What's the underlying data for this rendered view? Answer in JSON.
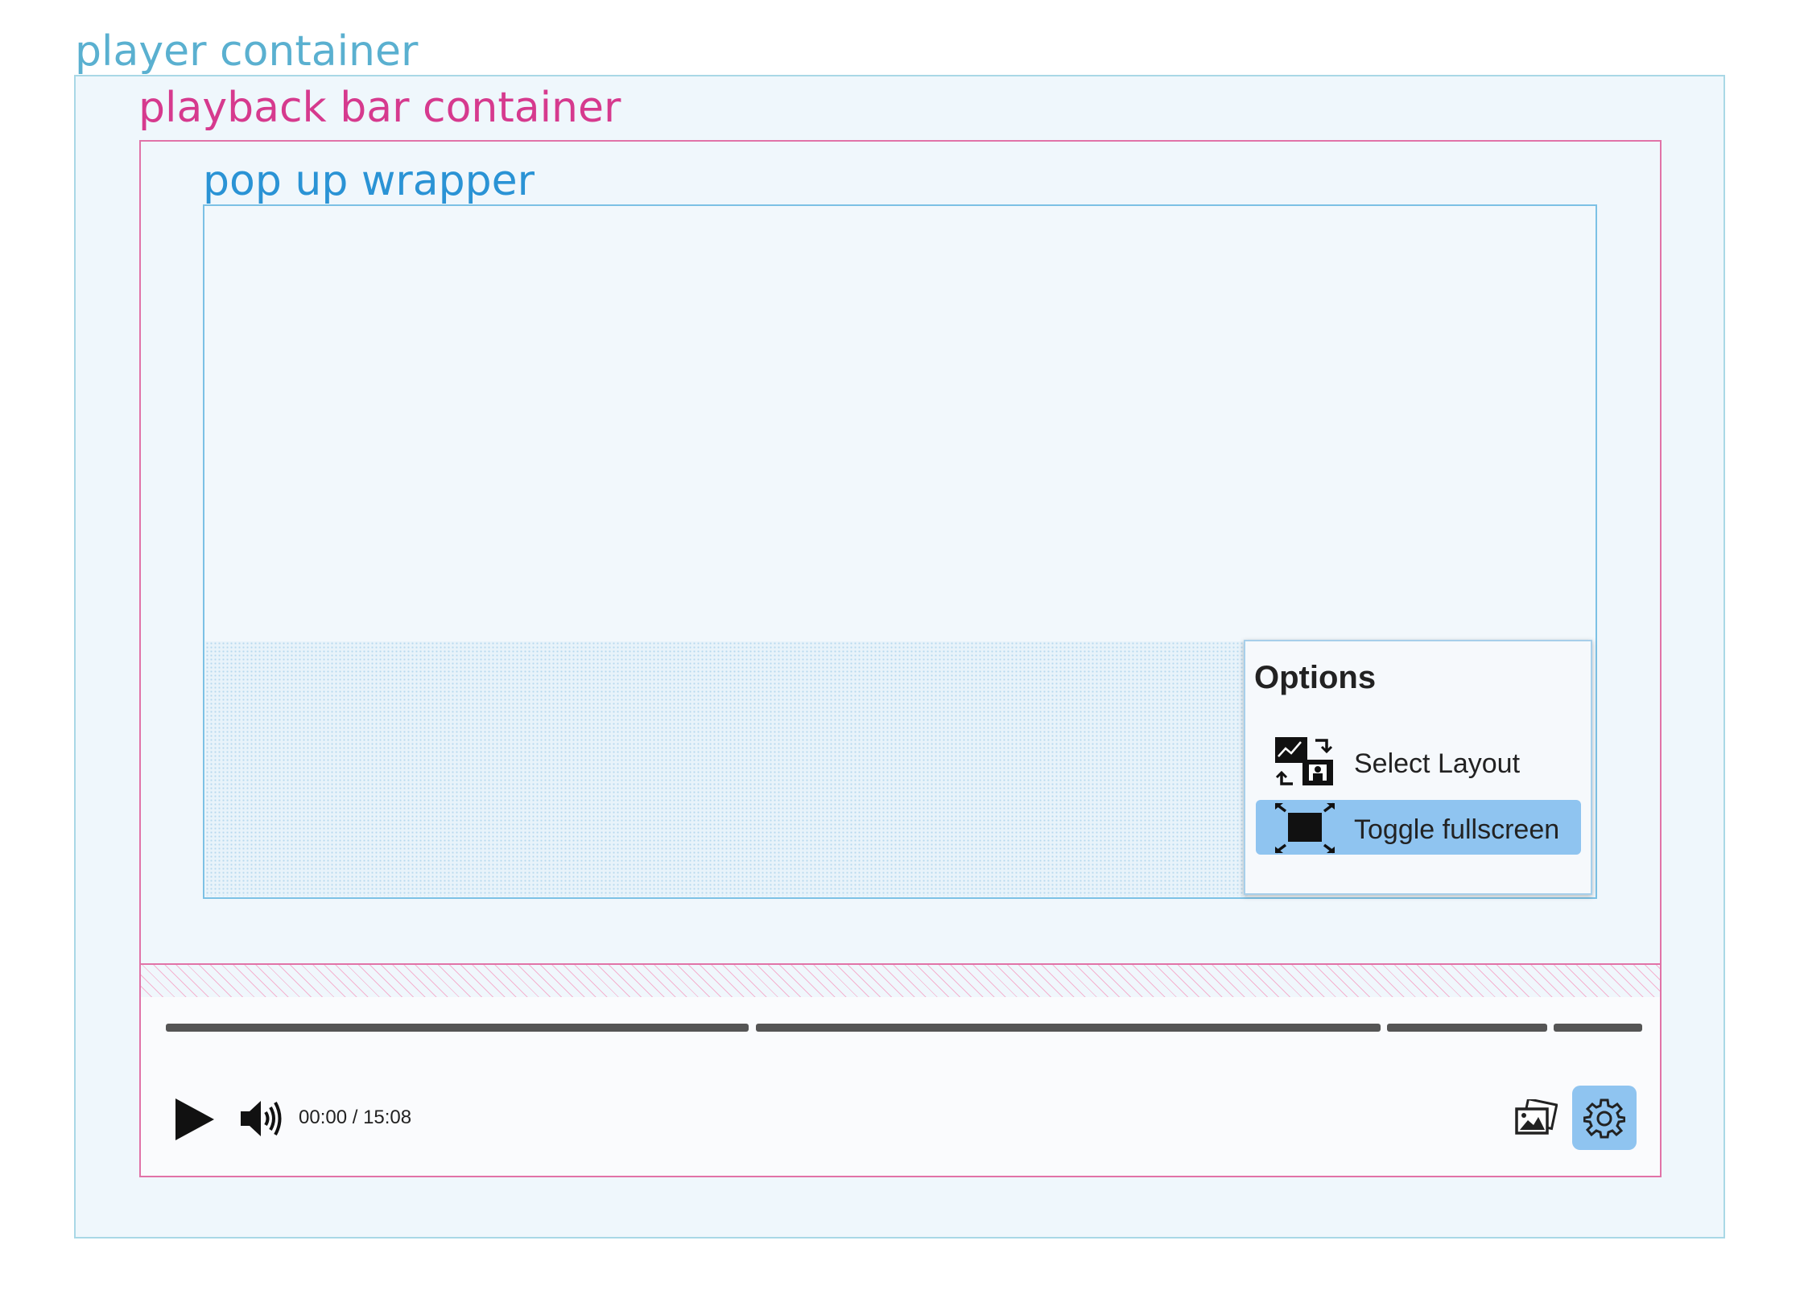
{
  "labels": {
    "player_container": "player container",
    "playback_bar_container": "playback bar container",
    "popup_wrapper": "pop up wrapper"
  },
  "colors": {
    "player_border": "#a9d8e6",
    "playback_bar_border": "#e173a8",
    "popup_border": "#7cc1e5",
    "highlight": "#8fc4f0"
  },
  "options_menu": {
    "title": "Options",
    "items": [
      {
        "label": "Select Layout",
        "icon": "layout-icon",
        "highlighted": false
      },
      {
        "label": "Toggle fullscreen",
        "icon": "fullscreen-icon",
        "highlighted": true
      }
    ]
  },
  "playback": {
    "time": "00:00 / 15:08",
    "segments": 4,
    "controls": {
      "play": "play-icon",
      "volume": "volume-icon",
      "gallery": "gallery-icon",
      "settings": "gear-icon"
    }
  }
}
